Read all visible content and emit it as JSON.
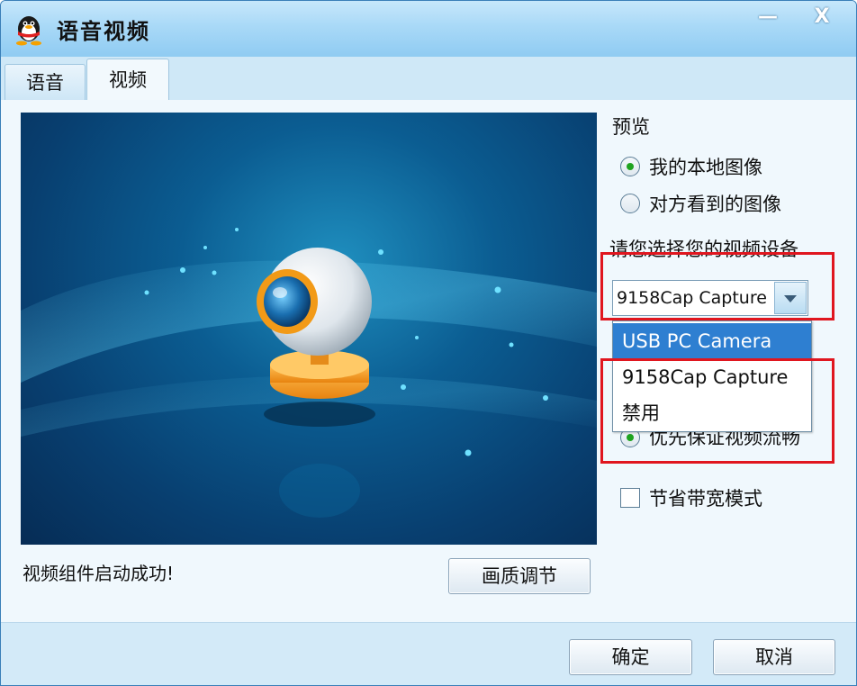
{
  "window": {
    "title": "语音视频",
    "minimize_label": "—",
    "close_label": "X"
  },
  "tabs": [
    {
      "label": "语音",
      "selected": false
    },
    {
      "label": "视频",
      "selected": true
    }
  ],
  "preview_section": {
    "heading": "预览",
    "options": [
      {
        "label": "我的本地图像",
        "checked": true
      },
      {
        "label": "对方看到的图像",
        "checked": false
      }
    ]
  },
  "device_section": {
    "heading": "请您选择您的视频设备",
    "selected_device": "9158Cap Capture",
    "dropdown_items": [
      "USB PC Camera",
      "9158Cap Capture",
      "禁用"
    ],
    "highlighted_item": "USB PC Camera"
  },
  "quality_option": {
    "label": "优先保证视频流畅",
    "checked": true
  },
  "bandwidth_option": {
    "label": "节省带宽模式",
    "checked": false
  },
  "status": {
    "text": "视频组件启动成功!"
  },
  "buttons": {
    "quality": "画质调节",
    "ok": "确定",
    "cancel": "取消"
  },
  "colors": {
    "highlight": "#2e7fd1",
    "annotation_red": "#e0161f",
    "radio_green": "#1fa31f"
  }
}
